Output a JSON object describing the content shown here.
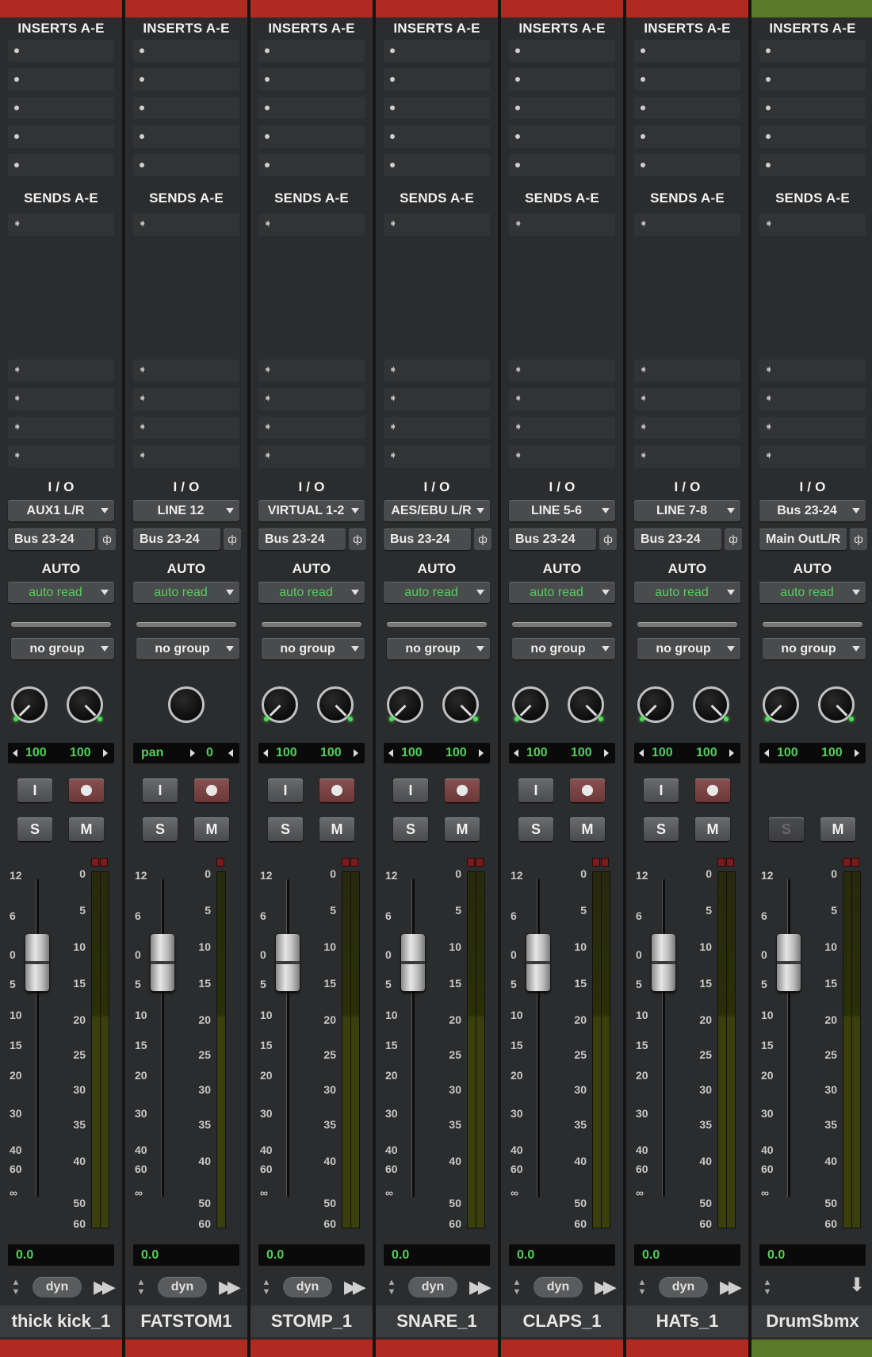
{
  "labels": {
    "inserts": "INSERTS A-E",
    "sends": "SENDS A-E",
    "io": "I / O",
    "auto": "AUTO",
    "solo": "S",
    "mute": "M",
    "input": "I",
    "dyn": "dyn"
  },
  "fader_scale": [
    "12",
    "6",
    "0",
    "5",
    "10",
    "15",
    "20",
    "30",
    "40",
    "60",
    "∞"
  ],
  "meter_scale": [
    "0",
    "5",
    "10",
    "15",
    "20",
    "25",
    "30",
    "35",
    "40",
    "50",
    "60"
  ],
  "tracks": [
    {
      "name": "thick kick_1",
      "color": "#b02a22",
      "input": "AUX1 L/R",
      "output": "Bus 23-24",
      "automation": "auto read",
      "group": "no group",
      "pan_type": "stereo",
      "pan_left": "100",
      "pan_right": "100",
      "volume": "0.0",
      "has_record": true,
      "solo_enabled": true,
      "bottom_control": "dyn"
    },
    {
      "name": "FATSTOM1",
      "color": "#b02a22",
      "input": "LINE 12",
      "output": "Bus 23-24",
      "automation": "auto read",
      "group": "no group",
      "pan_type": "mono",
      "pan_label": "pan",
      "pan_value": "0",
      "volume": "0.0",
      "has_record": true,
      "solo_enabled": true,
      "bottom_control": "dyn"
    },
    {
      "name": "STOMP_1",
      "color": "#b02a22",
      "input": "VIRTUAL 1-2",
      "output": "Bus 23-24",
      "automation": "auto read",
      "group": "no group",
      "pan_type": "stereo",
      "pan_left": "100",
      "pan_right": "100",
      "volume": "0.0",
      "has_record": true,
      "solo_enabled": true,
      "bottom_control": "dyn"
    },
    {
      "name": "SNARE_1",
      "color": "#b02a22",
      "input": "AES/EBU L/R",
      "output": "Bus 23-24",
      "automation": "auto read",
      "group": "no group",
      "pan_type": "stereo",
      "pan_left": "100",
      "pan_right": "100",
      "volume": "0.0",
      "has_record": true,
      "solo_enabled": true,
      "bottom_control": "dyn"
    },
    {
      "name": "CLAPS_1",
      "color": "#b02a22",
      "input": "LINE 5-6",
      "output": "Bus 23-24",
      "automation": "auto read",
      "group": "no group",
      "pan_type": "stereo",
      "pan_left": "100",
      "pan_right": "100",
      "volume": "0.0",
      "has_record": true,
      "solo_enabled": true,
      "bottom_control": "dyn"
    },
    {
      "name": "HATs_1",
      "color": "#b02a22",
      "input": "LINE 7-8",
      "output": "Bus 23-24",
      "automation": "auto read",
      "group": "no group",
      "pan_type": "stereo",
      "pan_left": "100",
      "pan_right": "100",
      "volume": "0.0",
      "has_record": true,
      "solo_enabled": true,
      "bottom_control": "dyn"
    },
    {
      "name": "DrumSbmx",
      "color": "#5a7a2a",
      "input": "Bus 23-24",
      "output": "Main OutL/R",
      "automation": "auto read",
      "group": "no group",
      "pan_type": "stereo",
      "pan_left": "100",
      "pan_right": "100",
      "volume": "0.0",
      "has_record": false,
      "solo_enabled": false,
      "bottom_control": "down-arrow"
    }
  ]
}
